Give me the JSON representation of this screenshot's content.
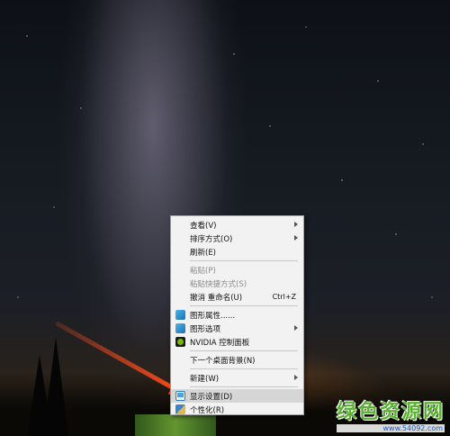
{
  "context_menu": {
    "items": [
      {
        "label": "查看(V)",
        "disabled": false,
        "submenu": true
      },
      {
        "label": "排序方式(O)",
        "disabled": false,
        "submenu": true
      },
      {
        "label": "刷新(E)",
        "disabled": false
      },
      {
        "label": "粘贴(P)",
        "disabled": true
      },
      {
        "label": "粘贴快捷方式(S)",
        "disabled": true
      },
      {
        "label": "撤消 重命名(U)",
        "shortcut": "Ctrl+Z",
        "disabled": false
      },
      {
        "label": "图形属性......",
        "icon": "graphics-icon"
      },
      {
        "label": "图形选项",
        "icon": "graphics-icon",
        "submenu": true
      },
      {
        "label": "NVIDIA 控制面板",
        "icon": "nvidia-icon"
      },
      {
        "label": "下一个桌面背景(N)"
      },
      {
        "label": "新建(W)",
        "submenu": true
      },
      {
        "label": "显示设置(D)",
        "icon": "display-icon",
        "highlighted": true
      },
      {
        "label": "个性化(R)",
        "icon": "personalize-icon"
      }
    ]
  },
  "watermark": {
    "title": "绿色资源网",
    "url": "www.54092.com"
  },
  "colors": {
    "arrow": "#ff4a1c",
    "menu_bg": "#f2f2f2",
    "highlight": "#d6d6d6",
    "watermark_green": "#5ab031"
  }
}
